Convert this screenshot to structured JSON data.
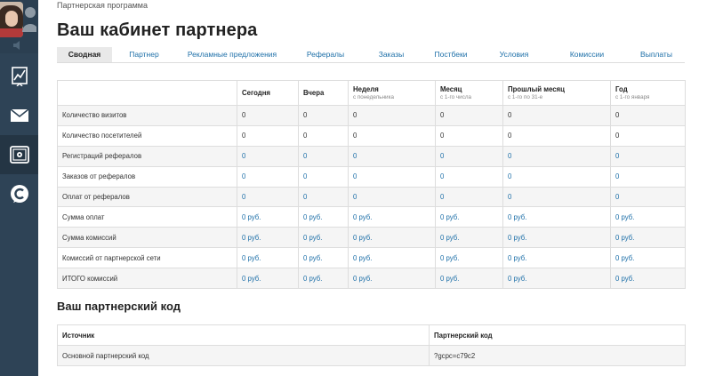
{
  "breadcrumb": "Партнерская программа",
  "page_title": "Ваш кабинет партнера",
  "tabs": [
    {
      "label": "Сводная",
      "active": true
    },
    {
      "label": "Партнер"
    },
    {
      "label": "Рекламные предложения"
    },
    {
      "label": "Рефералы"
    },
    {
      "label": "Заказы"
    },
    {
      "label": "Постбеки"
    },
    {
      "label": "Условия"
    },
    {
      "label": "Комиссии"
    },
    {
      "label": "Выплаты"
    }
  ],
  "stats": {
    "headers": [
      {
        "label": "",
        "sub": ""
      },
      {
        "label": "Сегодня",
        "sub": ""
      },
      {
        "label": "Вчера",
        "sub": ""
      },
      {
        "label": "Неделя",
        "sub": "с понедельника"
      },
      {
        "label": "Месяц",
        "sub": "с 1-го числа"
      },
      {
        "label": "Прошлый месяц",
        "sub": "с 1-го по 31-е"
      },
      {
        "label": "Год",
        "sub": "с 1-го января"
      }
    ],
    "rows": [
      {
        "label": "Количество визитов",
        "values": [
          "0",
          "0",
          "0",
          "0",
          "0",
          "0"
        ],
        "link": false
      },
      {
        "label": "Количество посетителей",
        "values": [
          "0",
          "0",
          "0",
          "0",
          "0",
          "0"
        ],
        "link": false
      },
      {
        "label": "Регистраций рефералов",
        "values": [
          "0",
          "0",
          "0",
          "0",
          "0",
          "0"
        ],
        "link": true
      },
      {
        "label": "Заказов от рефералов",
        "values": [
          "0",
          "0",
          "0",
          "0",
          "0",
          "0"
        ],
        "link": true
      },
      {
        "label": "Оплат от рефералов",
        "values": [
          "0",
          "0",
          "0",
          "0",
          "0",
          "0"
        ],
        "link": true
      },
      {
        "label": "Сумма оплат",
        "values": [
          "0 руб.",
          "0 руб.",
          "0 руб.",
          "0 руб.",
          "0 руб.",
          "0 руб."
        ],
        "link": true
      },
      {
        "label": "Сумма комиссий",
        "values": [
          "0 руб.",
          "0 руб.",
          "0 руб.",
          "0 руб.",
          "0 руб.",
          "0 руб."
        ],
        "link": true
      },
      {
        "label": "Комиссий от партнерской сети",
        "values": [
          "0 руб.",
          "0 руб.",
          "0 руб.",
          "0 руб.",
          "0 руб.",
          "0 руб."
        ],
        "link": true
      },
      {
        "label": "ИТОГО комиссий",
        "values": [
          "0 руб.",
          "0 руб.",
          "0 руб.",
          "0 руб.",
          "0 руб.",
          "0 руб."
        ],
        "link": true
      }
    ]
  },
  "partner_code": {
    "title": "Ваш партнерский код",
    "headers": [
      "Источник",
      "Партнерский код"
    ],
    "rows": [
      {
        "source": "Основной партнерский код",
        "code": "?gcpc=c79c2"
      }
    ]
  },
  "sidebar": {
    "items": [
      {
        "icon": "chart-icon",
        "active": false
      },
      {
        "icon": "mail-icon",
        "active": false
      },
      {
        "icon": "safe-icon",
        "active": true
      },
      {
        "icon": "brand-c-icon",
        "active": false
      }
    ]
  },
  "colors": {
    "sidebar_bg": "#2e4356",
    "link": "#1d6fa8",
    "row_alt": "#f5f5f5",
    "tab_active_bg": "#e9e9e9"
  }
}
